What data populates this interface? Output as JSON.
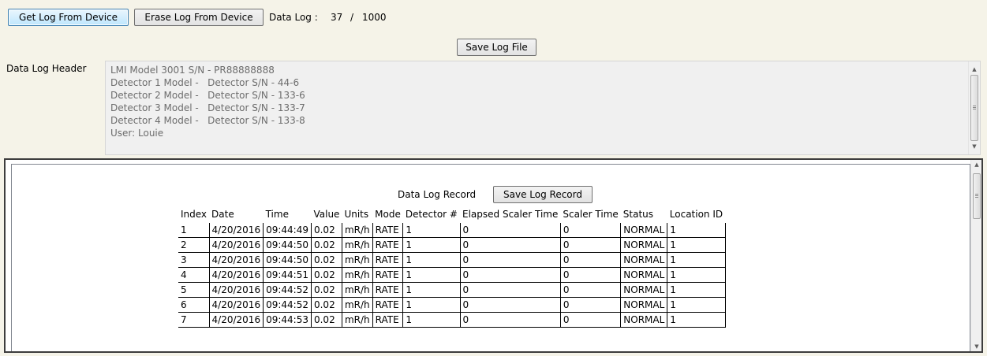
{
  "toolbar": {
    "get_log_label": "Get Log From Device",
    "erase_log_label": "Erase Log From Device",
    "data_log_label": "Data Log :",
    "data_log_count": "37",
    "data_log_separator": "/",
    "data_log_max": "1000",
    "save_log_file_label": "Save Log File"
  },
  "header": {
    "label": "Data Log Header",
    "lines": [
      "LMI Model 3001 S/N - PR88888888",
      "Detector 1 Model -   Detector S/N - 44-6",
      "Detector 2 Model -   Detector S/N - 133-6",
      "Detector 3 Model -   Detector S/N - 133-7",
      "Detector 4 Model -   Detector S/N - 133-8",
      "User: Louie"
    ]
  },
  "record": {
    "title": "Data Log Record",
    "save_label": "Save Log Record",
    "columns": [
      "Index",
      "Date",
      "Time",
      "Value",
      "Units",
      "Mode",
      "Detector #",
      "Elapsed Scaler Time",
      "Scaler Time",
      "Status",
      "Location ID"
    ],
    "rows": [
      [
        "1",
        "4/20/2016",
        "09:44:49",
        "0.02",
        "mR/h",
        "RATE",
        "1",
        "0",
        "0",
        "NORMAL",
        "1"
      ],
      [
        "2",
        "4/20/2016",
        "09:44:50",
        "0.02",
        "mR/h",
        "RATE",
        "1",
        "0",
        "0",
        "NORMAL",
        "1"
      ],
      [
        "3",
        "4/20/2016",
        "09:44:50",
        "0.02",
        "mR/h",
        "RATE",
        "1",
        "0",
        "0",
        "NORMAL",
        "1"
      ],
      [
        "4",
        "4/20/2016",
        "09:44:51",
        "0.02",
        "mR/h",
        "RATE",
        "1",
        "0",
        "0",
        "NORMAL",
        "1"
      ],
      [
        "5",
        "4/20/2016",
        "09:44:52",
        "0.02",
        "mR/h",
        "RATE",
        "1",
        "0",
        "0",
        "NORMAL",
        "1"
      ],
      [
        "6",
        "4/20/2016",
        "09:44:52",
        "0.02",
        "mR/h",
        "RATE",
        "1",
        "0",
        "0",
        "NORMAL",
        "1"
      ],
      [
        "7",
        "4/20/2016",
        "09:44:53",
        "0.02",
        "mR/h",
        "RATE",
        "1",
        "0",
        "0",
        "NORMAL",
        "1"
      ]
    ]
  },
  "icons": {
    "scroll_up": "chevron-up-icon",
    "scroll_down": "chevron-down-icon"
  },
  "colors": {
    "window_background": "#f5f3e8",
    "header_text": "#6d6d6d",
    "focused_button_border": "#3c7fb1"
  }
}
